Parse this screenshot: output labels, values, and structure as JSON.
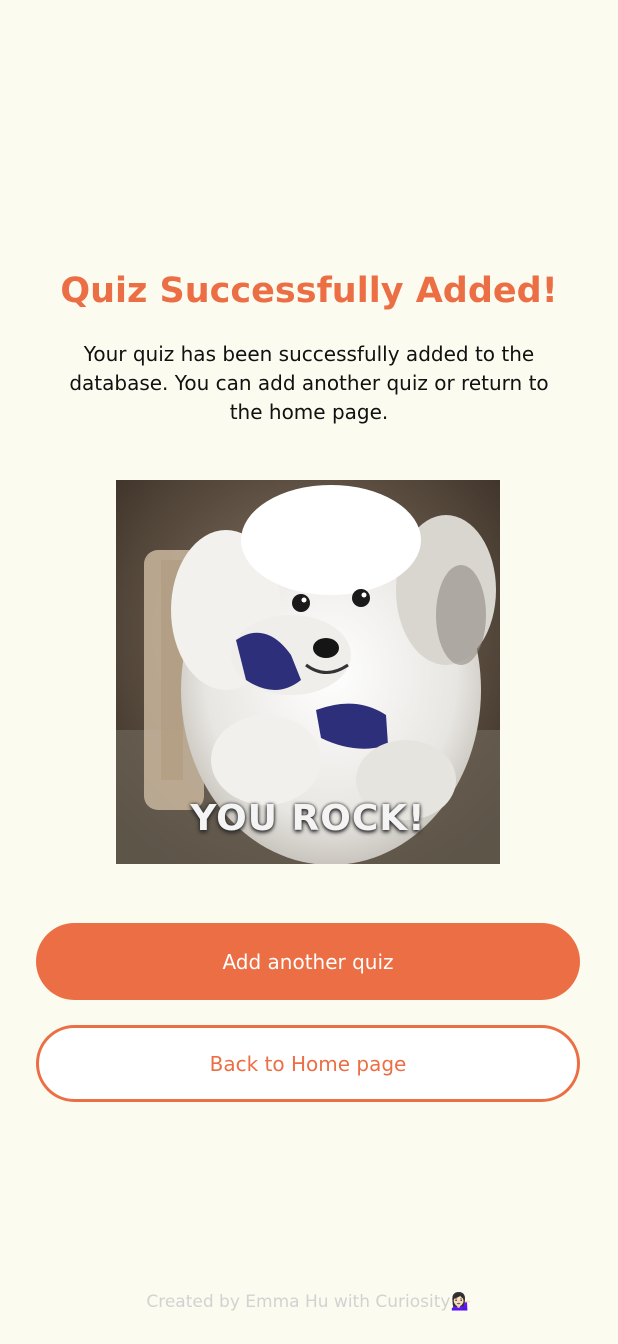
{
  "page": {
    "title": "Quiz Successfully Added!",
    "description": "Your quiz has been successfully added to the database. You can add another quiz or return to the home page.",
    "image": {
      "caption": "YOU ROCK!"
    },
    "buttons": {
      "add_label": "Add another quiz",
      "home_label": "Back to Home page"
    },
    "footer": {
      "text": "Created by Emma Hu with Curiosity",
      "emoji": "💁🏻‍♀️"
    }
  },
  "colors": {
    "background": "#fbfbef",
    "accent": "#ec6e45",
    "footer_text": "#d2d2d2"
  }
}
